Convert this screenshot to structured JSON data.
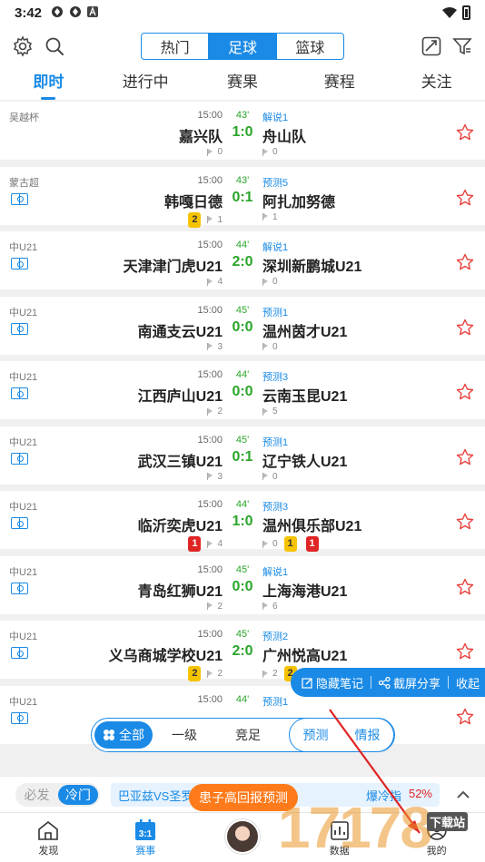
{
  "status_bar": {
    "time": "3:42"
  },
  "top_bar": {
    "segments": [
      {
        "label": "热门",
        "active": false
      },
      {
        "label": "足球",
        "active": true
      },
      {
        "label": "篮球",
        "active": false
      }
    ]
  },
  "tabs": [
    {
      "label": "即时",
      "active": true
    },
    {
      "label": "进行中",
      "active": false
    },
    {
      "label": "赛果",
      "active": false
    },
    {
      "label": "赛程",
      "active": false
    },
    {
      "label": "关注",
      "active": false
    }
  ],
  "matches": [
    {
      "league": "吴越杯",
      "pitch": false,
      "time": "15:00",
      "minute": "43'",
      "label": "解说1",
      "home": "嘉兴队",
      "score": "1:0",
      "away": "舟山队",
      "home_corners": "0",
      "away_corners": "0",
      "home_cards": [],
      "away_cards": []
    },
    {
      "league": "蒙古超",
      "pitch": true,
      "time": "15:00",
      "minute": "43'",
      "label": "预测5",
      "home": "韩嘎日德",
      "score": "0:1",
      "away": "阿扎加努德",
      "home_corners": "1",
      "away_corners": "1",
      "home_cards": [
        {
          "type": "yellow",
          "n": "2"
        }
      ],
      "away_cards": []
    },
    {
      "league": "中U21",
      "pitch": true,
      "time": "15:00",
      "minute": "44'",
      "label": "解说1",
      "home": "天津津门虎U21",
      "score": "2:0",
      "away": "深圳新鹏城U21",
      "home_corners": "4",
      "away_corners": "0",
      "home_cards": [],
      "away_cards": []
    },
    {
      "league": "中U21",
      "pitch": true,
      "time": "15:00",
      "minute": "45'",
      "label": "预测1",
      "home": "南通支云U21",
      "score": "0:0",
      "away": "温州茵才U21",
      "home_corners": "3",
      "away_corners": "0",
      "home_cards": [],
      "away_cards": []
    },
    {
      "league": "中U21",
      "pitch": true,
      "time": "15:00",
      "minute": "44'",
      "label": "预测3",
      "home": "江西庐山U21",
      "score": "0:0",
      "away": "云南玉昆U21",
      "home_corners": "2",
      "away_corners": "5",
      "home_cards": [],
      "away_cards": []
    },
    {
      "league": "中U21",
      "pitch": true,
      "time": "15:00",
      "minute": "45'",
      "label": "预测1",
      "home": "武汉三镇U21",
      "score": "0:1",
      "away": "辽宁铁人U21",
      "home_corners": "3",
      "away_corners": "0",
      "home_cards": [],
      "away_cards": []
    },
    {
      "league": "中U21",
      "pitch": true,
      "time": "15:00",
      "minute": "44'",
      "label": "预测3",
      "home": "临沂奕虎U21",
      "score": "1:0",
      "away": "温州俱乐部U21",
      "home_corners": "4",
      "away_corners": "0",
      "home_cards": [
        {
          "type": "red",
          "n": "1"
        }
      ],
      "away_cards": [
        {
          "type": "yellow",
          "n": "1"
        },
        {
          "type": "red",
          "n": "1"
        }
      ]
    },
    {
      "league": "中U21",
      "pitch": true,
      "time": "15:00",
      "minute": "45'",
      "label": "解说1",
      "home": "青岛红狮U21",
      "score": "0:0",
      "away": "上海海港U21",
      "home_corners": "2",
      "away_corners": "6",
      "home_cards": [],
      "away_cards": []
    },
    {
      "league": "中U21",
      "pitch": true,
      "time": "15:00",
      "minute": "45'",
      "label": "预测2",
      "home": "义乌商城学校U21",
      "score": "2:0",
      "away": "广州悦高U21",
      "home_corners": "2",
      "away_corners": "2",
      "home_cards": [
        {
          "type": "yellow",
          "n": "2"
        }
      ],
      "away_cards": [
        {
          "type": "yellow",
          "n": "2"
        }
      ]
    },
    {
      "league": "中U21",
      "pitch": true,
      "time": "15:00",
      "minute": "44'",
      "label": "预测1",
      "home": "",
      "score": "",
      "away": "",
      "home_corners": "",
      "away_corners": "",
      "home_cards": [],
      "away_cards": []
    }
  ],
  "float_bar": {
    "hide_notes": "隐藏笔记",
    "share": "截屏分享",
    "collapse": "收起"
  },
  "filter_bar": {
    "all": "全部",
    "level1": "一级",
    "jingzu": "竞足",
    "predict": "预测",
    "report": "情报"
  },
  "ticker": {
    "toggle_off": "必发",
    "toggle_on": "冷门",
    "headline_left": "巴亚兹VS圣罗",
    "headline_right": "爆冷指",
    "percent": "52%"
  },
  "promo": "患子高回报预测",
  "bottom_nav": [
    {
      "label": "发现",
      "icon": "home-icon",
      "active": false
    },
    {
      "label": "赛事",
      "icon": "calendar-icon",
      "active": true,
      "icon_text": "3:1"
    },
    {
      "label": "",
      "icon": "avatar",
      "active": false
    },
    {
      "label": "数据",
      "icon": "data-icon",
      "active": false
    },
    {
      "label": "我的",
      "icon": "user-icon",
      "active": false
    }
  ],
  "watermark": {
    "text": "17178",
    "badge": "下载站"
  },
  "colors": {
    "accent": "#1a8ae6",
    "score_green": "#2aa52a",
    "yellow_card": "#f5c300",
    "red_card": "#e02424",
    "promo_orange": "#ff7a1a"
  }
}
